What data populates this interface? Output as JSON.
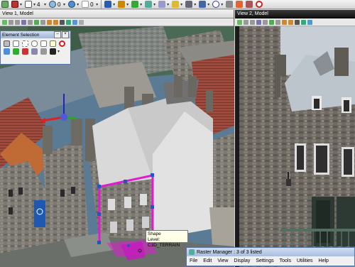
{
  "toolbar": {
    "level_value": "4",
    "snap_value": "0",
    "number_value": "0"
  },
  "view1": {
    "title": "View 1, Model"
  },
  "view2": {
    "title": "View 2, Model"
  },
  "element_selection": {
    "title": "Element Selection"
  },
  "tooltip": {
    "line1": "Shape",
    "line2": "Level: C3D_TERRAIN"
  },
  "raster_manager": {
    "title": "Raster Manager : 3 of 3 listed",
    "menu": [
      "File",
      "Edit",
      "View",
      "Display",
      "Settings",
      "Tools",
      "Utilities",
      "Help"
    ]
  },
  "colors": {
    "selection": "#e01bd0",
    "handle": "#1e56c8",
    "window_dark": "#1a1a1a"
  }
}
